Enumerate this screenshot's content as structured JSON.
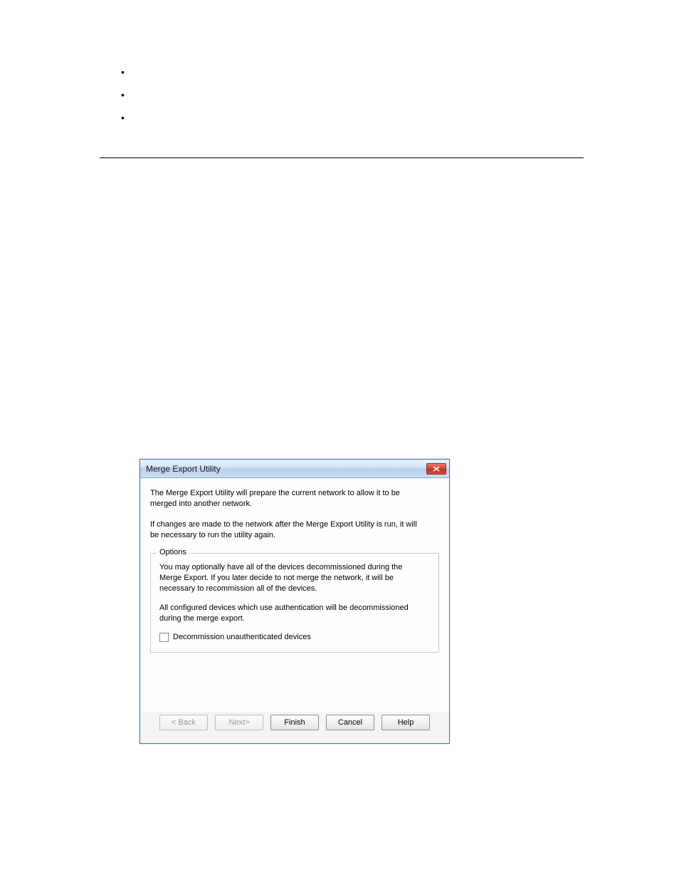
{
  "page": {
    "bullets": [
      "",
      "",
      ""
    ]
  },
  "dialog": {
    "title": "Merge Export Utility",
    "intro1": "The Merge Export Utility will prepare the current network to allow it to be merged into another network.",
    "intro2": "If changes are made to the network after the Merge Export Utility is run, it will be necessary to run the utility again.",
    "options": {
      "legend": "Options",
      "para1": "You may optionally have all of the devices decommissioned during the Merge Export. If you later decide to not merge the network, it will be necessary to recommission all of the devices.",
      "para2": "All configured devices which use authentication will be decommissioned during the merge export.",
      "checkbox_label": "Decommission unauthenticated devices",
      "checkbox_checked": false
    },
    "buttons": {
      "back": "< Back",
      "next": "Next>",
      "finish": "Finish",
      "cancel": "Cancel",
      "help": "Help"
    }
  }
}
